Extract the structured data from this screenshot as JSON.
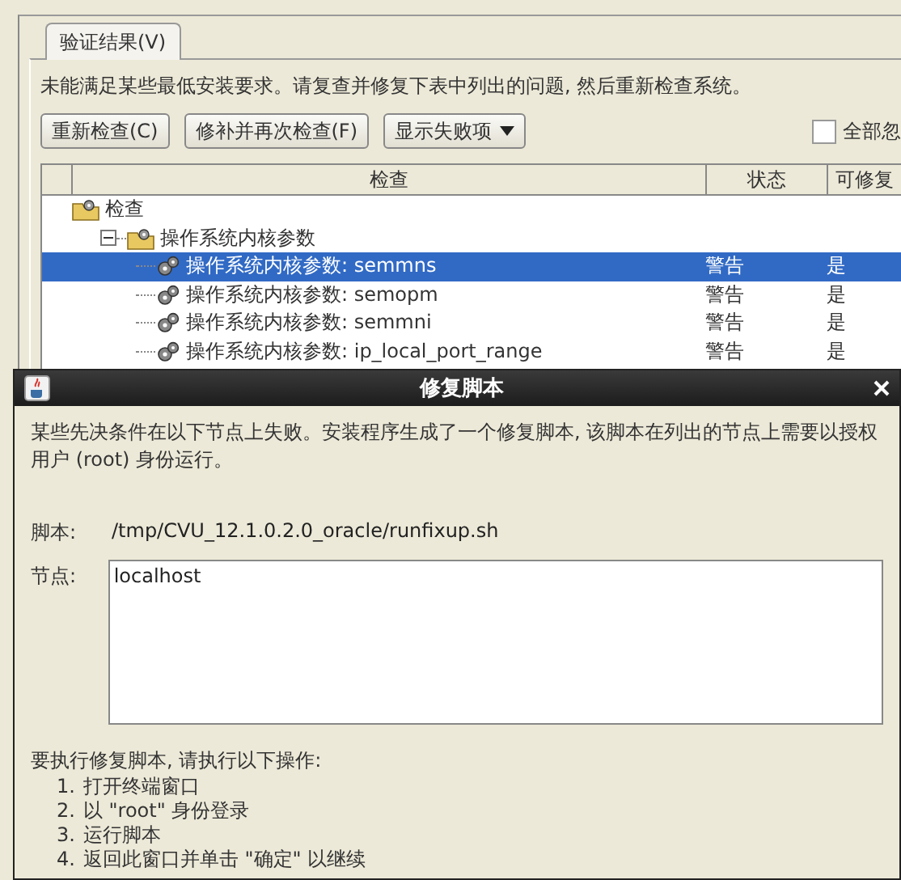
{
  "main_window": {
    "tabs": [
      {
        "label": "验证结果(V)",
        "selected": true
      }
    ],
    "message": "未能满足某些最低安装要求。请复查并修复下表中列出的问题, 然后重新检查系统。",
    "buttons": [
      {
        "label": "重新检查(C)",
        "kind": "button"
      },
      {
        "label": "修补并再次检查(F)",
        "kind": "button"
      },
      {
        "label": "显示失败项",
        "kind": "dropdown"
      }
    ],
    "ignore_all": {
      "label": "全部忽",
      "checked": false
    },
    "table": {
      "columns": [
        "检查",
        "状态",
        "可修复"
      ],
      "tree": [
        {
          "label": "检查",
          "children": [
            {
              "label": "操作系统内核参数",
              "expanded": true,
              "children": [
                {
                  "label": "操作系统内核参数: semmns",
                  "status": "警告",
                  "fixable": "是",
                  "selected": true
                },
                {
                  "label": "操作系统内核参数: semopm",
                  "status": "警告",
                  "fixable": "是",
                  "selected": false
                },
                {
                  "label": "操作系统内核参数: semmni",
                  "status": "警告",
                  "fixable": "是",
                  "selected": false
                },
                {
                  "label": "操作系统内核参数: ip_local_port_range",
                  "status": "警告",
                  "fixable": "是",
                  "selected": false
                }
              ]
            }
          ]
        }
      ]
    }
  },
  "dialog": {
    "title": "修复脚本",
    "description": "某些先决条件在以下节点上失败。安装程序生成了一个修复脚本, 该脚本在列出的节点上需要以授权用户 (root) 身份运行。",
    "script_label": "脚本:",
    "script_path": "/tmp/CVU_12.1.0.2.0_oracle/runfixup.sh",
    "nodes_label": "节点:",
    "nodes_value": "localhost",
    "instructions_intro": "要执行修复脚本, 请执行以下操作:",
    "steps": [
      {
        "number": "1.",
        "text": "打开终端窗口"
      },
      {
        "number": "2.",
        "text": "以 \"root\" 身份登录"
      },
      {
        "number": "3.",
        "text": "运行脚本"
      },
      {
        "number": "4.",
        "text": "返回此窗口并单击 \"确定\" 以继续"
      }
    ]
  }
}
